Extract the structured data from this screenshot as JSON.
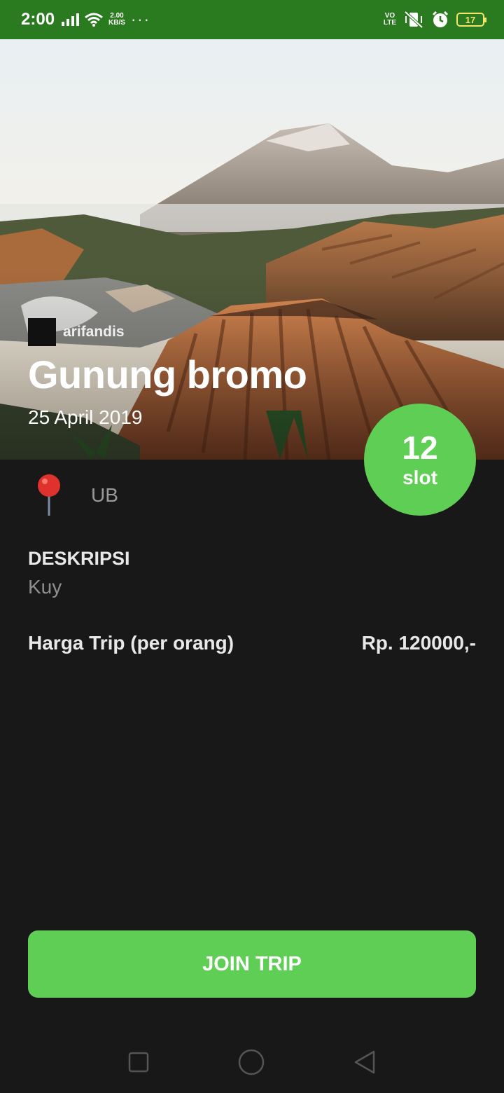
{
  "status_bar": {
    "time": "2:00",
    "net_speed_value": "2.00",
    "net_speed_unit": "KB/S",
    "overflow": "···",
    "volte_top": "VO",
    "volte_bottom": "LTE",
    "battery": "17",
    "bar_color": "#2a7a1f"
  },
  "trip": {
    "author": "arifandis",
    "title": "Gunung bromo",
    "date": "25 April 2019",
    "slot_count": "12",
    "slot_unit": "slot",
    "location": "UB",
    "description_label": "DESKRIPSI",
    "description": "Kuy",
    "price_label": "Harga Trip (per orang)",
    "price_value": "Rp. 120000,-"
  },
  "actions": {
    "join_label": "JOIN TRIP"
  },
  "colors": {
    "accent": "#5fce55",
    "background": "#181818"
  },
  "icons": {
    "location": "pin-icon",
    "nav_recents": "square-icon",
    "nav_home": "circle-icon",
    "nav_back": "triangle-back-icon"
  }
}
